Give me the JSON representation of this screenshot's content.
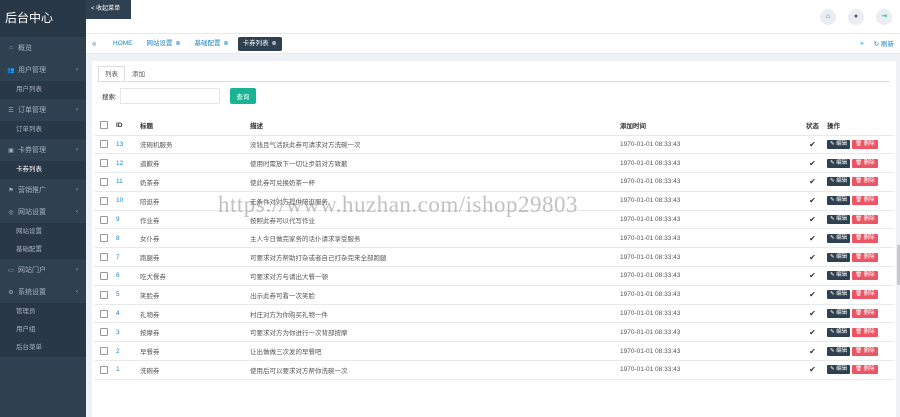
{
  "brand": "后台中心",
  "back_button": "< 收起菜单",
  "sidebar": {
    "items": [
      {
        "icon": "home-icon",
        "glyph": "⌂",
        "label": "概览",
        "has_caret": false
      },
      {
        "icon": "user-icon",
        "glyph": "👥",
        "label": "用户管理",
        "has_caret": true,
        "sub": [
          "用户列表"
        ]
      },
      {
        "icon": "list-icon",
        "glyph": "☰",
        "label": "订单管理",
        "has_caret": true,
        "sub": [
          "订单列表"
        ]
      },
      {
        "icon": "ticket-icon",
        "glyph": "▣",
        "label": "卡券管理",
        "has_caret": true,
        "sub": [
          "卡券列表"
        ],
        "active_sub": 0
      },
      {
        "icon": "flag-icon",
        "glyph": "⚑",
        "label": "营销推广",
        "has_caret": true
      },
      {
        "icon": "globe-icon",
        "glyph": "◎",
        "label": "网站设置",
        "has_caret": true,
        "sub": [
          "网站设置",
          "基础配置"
        ]
      },
      {
        "icon": "portal-icon",
        "glyph": "▭",
        "label": "网站门户",
        "has_caret": true
      },
      {
        "icon": "gear-icon",
        "glyph": "⚙",
        "label": "系统设置",
        "has_caret": true,
        "sub": [
          "管理员",
          "用户组",
          "后台菜单"
        ]
      }
    ]
  },
  "tabs": [
    {
      "label": "HOME",
      "closable": false,
      "active": false
    },
    {
      "label": "网站设置",
      "closable": true,
      "active": false
    },
    {
      "label": "基础配置",
      "closable": true,
      "active": false
    },
    {
      "label": "卡券列表",
      "closable": true,
      "active": true
    }
  ],
  "tab_right": {
    "refresh": "刷新"
  },
  "sub_tabs": [
    "列表",
    "添加"
  ],
  "search": {
    "label": "搜索:",
    "value": "",
    "button": "查询"
  },
  "table": {
    "headers": [
      "ID",
      "标题",
      "描述",
      "添加时间",
      "状态",
      "操作"
    ],
    "edit_label": "✎ 编辑",
    "delete_label": "🗑 删除",
    "rows": [
      {
        "id": "13",
        "title": "洗碗机服务",
        "desc": "没钱且气活跃此券可请求对方洗碗一次",
        "time": "1970-01-01 08:33:43"
      },
      {
        "id": "12",
        "title": "道歉券",
        "desc": "使用时需放下一切让步前对方致歉",
        "time": "1970-01-01 08:33:43"
      },
      {
        "id": "11",
        "title": "奶茶券",
        "desc": "使此券可兑换奶茶一杯",
        "time": "1970-01-01 08:33:43"
      },
      {
        "id": "10",
        "title": "陪逛券",
        "desc": "无条件对对方提供陪逛服务",
        "time": "1970-01-01 08:33:43"
      },
      {
        "id": "9",
        "title": "作业券",
        "desc": "按照此券可以代写作业",
        "time": "1970-01-01 08:33:43"
      },
      {
        "id": "8",
        "title": "女仆券",
        "desc": "主人今日做完家务的话仆请求享受服务",
        "time": "1970-01-01 08:33:43"
      },
      {
        "id": "7",
        "title": "跑腿券",
        "desc": "可要求对方帮助打杂或者自己打杂完来全部跑腿",
        "time": "1970-01-01 08:33:43"
      },
      {
        "id": "6",
        "title": "吃大餐券",
        "desc": "可要求对方与请出大餐一顿",
        "time": "1970-01-01 08:33:43"
      },
      {
        "id": "5",
        "title": "笑脸券",
        "desc": "出示此券可看一次笑脸",
        "time": "1970-01-01 08:33:43"
      },
      {
        "id": "4",
        "title": "礼物券",
        "desc": "村庄对方为你购买礼物一件",
        "time": "1970-01-01 08:33:43"
      },
      {
        "id": "3",
        "title": "按摩券",
        "desc": "可要求对方为你进行一次背部按摩",
        "time": "1970-01-01 08:33:43"
      },
      {
        "id": "2",
        "title": "早餐券",
        "desc": "让出做做三次发的早餐吧",
        "time": "1970-01-01 08:33:43"
      },
      {
        "id": "1",
        "title": "洗碗券",
        "desc": "使用后可以要求对方帮你洗碗一次",
        "time": "1970-01-01 08:33:43"
      }
    ]
  },
  "watermark": "https://www.huzhan.com/ishop29803",
  "colors": {
    "sidebar": "#2f4050",
    "accent": "#1ab394",
    "link": "#1c84c6",
    "danger": "#ed5565"
  }
}
